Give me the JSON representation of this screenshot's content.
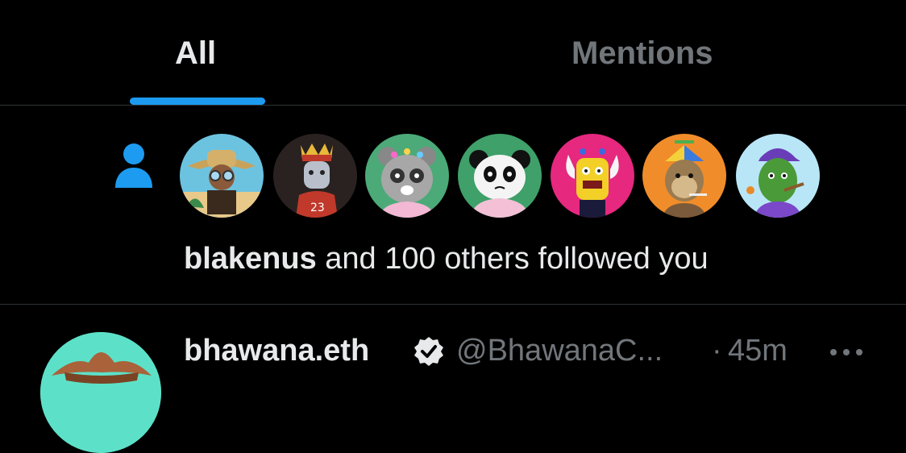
{
  "tabs": [
    {
      "label": "All",
      "selected": true
    },
    {
      "label": "Mentions",
      "selected": false
    }
  ],
  "colors": {
    "accent": "#1d9bf0",
    "background": "#000000",
    "secondary_text": "#71767b"
  },
  "notification": {
    "icon": "person-icon",
    "avatars": [
      "avatar-straw-hat-character",
      "avatar-crowned-basketball-player",
      "avatar-panda-flower-crown",
      "avatar-panda-pink-hoodie",
      "avatar-yellow-monster",
      "avatar-ape-propeller-cap",
      "avatar-weed-character-purple-cap"
    ],
    "name": "blakenus",
    "text": " and 100 others followed you"
  },
  "tweet": {
    "display_name": "bhawana.eth",
    "verified_icon": "verified-badge-icon",
    "handle": "@BhawanaC...",
    "separator": "·",
    "time": "45m",
    "more_icon": "more-options-icon"
  }
}
